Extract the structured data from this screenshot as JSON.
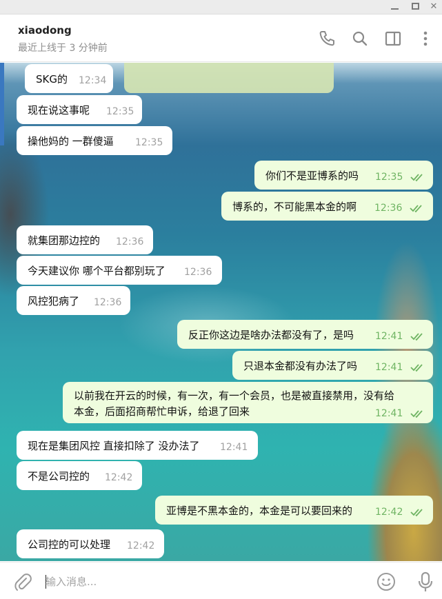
{
  "window": {
    "controls": [
      "minimize",
      "maximize",
      "close"
    ],
    "close_glyph": "✕"
  },
  "header": {
    "title": "xiaodong",
    "status": "最近上线于 3 分钟前",
    "icons": [
      "phone-icon",
      "search-icon",
      "sidebar-toggle-icon",
      "more-vertical-icon"
    ]
  },
  "messages": [
    {
      "dir": "in",
      "text": "SKG的",
      "time": "12:34"
    },
    {
      "dir": "in",
      "text": "现在说这事呢",
      "time": "12:35"
    },
    {
      "dir": "in",
      "text": "操他妈的 一群傻逼",
      "time": "12:35"
    },
    {
      "dir": "out",
      "text": "你们不是亚博系的吗",
      "time": "12:35",
      "read": true
    },
    {
      "dir": "out",
      "text": "博系的，不可能黑本金的啊",
      "time": "12:36",
      "read": true
    },
    {
      "dir": "in",
      "text": "就集团那边控的",
      "time": "12:36"
    },
    {
      "dir": "in",
      "text": "今天建议你 哪个平台都别玩了",
      "time": "12:36"
    },
    {
      "dir": "in",
      "text": "风控犯病了",
      "time": "12:36"
    },
    {
      "dir": "out",
      "text": "反正你这边是啥办法都没有了，是吗",
      "time": "12:41",
      "read": true
    },
    {
      "dir": "out",
      "text": "只退本金都没有办法了吗",
      "time": "12:41",
      "read": true
    },
    {
      "dir": "out",
      "line1": "以前我在开云的时候，有一次，有一个会员，也是被直接禁用，没有给",
      "line2": "本金，后面招商帮忙申诉，给退了回来",
      "time": "12:41",
      "read": true
    },
    {
      "dir": "in",
      "text": "现在是集团风控 直接扣除了 没办法了",
      "time": "12:41"
    },
    {
      "dir": "in",
      "text": "不是公司控的",
      "time": "12:42"
    },
    {
      "dir": "out",
      "text": "亚博是不黑本金的，本金是可以要回来的",
      "time": "12:42",
      "read": true
    },
    {
      "dir": "in",
      "text": "公司控的可以处理",
      "time": "12:42"
    }
  ],
  "composer": {
    "placeholder": "输入消息...",
    "icons": [
      "attach-icon",
      "emoji-icon",
      "microphone-icon"
    ]
  },
  "colors": {
    "incoming_bubble": "#ffffff",
    "outgoing_bubble": "#effdde",
    "read_check": "#6fb463",
    "time_in": "#a0a0a0"
  }
}
